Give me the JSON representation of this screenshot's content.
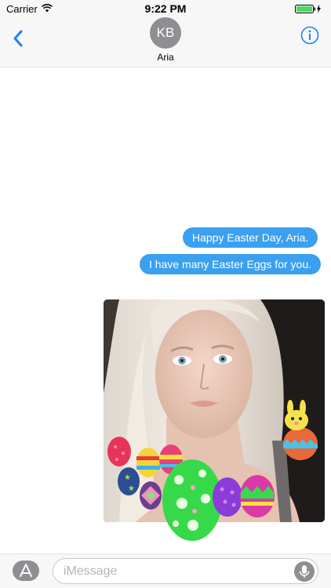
{
  "status_bar": {
    "carrier": "Carrier",
    "time": "9:22 PM",
    "icons": [
      "wifi-icon",
      "battery-icon",
      "charging-bolt-icon"
    ]
  },
  "header": {
    "avatar_initials": "KB",
    "contact_name": "Aria",
    "icons": [
      "chevron-left-icon",
      "info-icon"
    ]
  },
  "messages": [
    {
      "from": "me",
      "text": "Happy Easter Day, Aria."
    },
    {
      "from": "me",
      "text": "I have many Easter Eggs for you."
    }
  ],
  "attachment": {
    "type": "photo",
    "stickers": [
      "easter-egg-sticker",
      "bunny-in-egg-sticker"
    ]
  },
  "input_bar": {
    "placeholder": "iMessage",
    "icons": [
      "app-store-icon",
      "microphone-icon"
    ]
  },
  "colors": {
    "bubble": "#3aa0ef",
    "accent": "#1a82fb",
    "battery": "#4cd964",
    "avatar": "#8e8e93"
  }
}
